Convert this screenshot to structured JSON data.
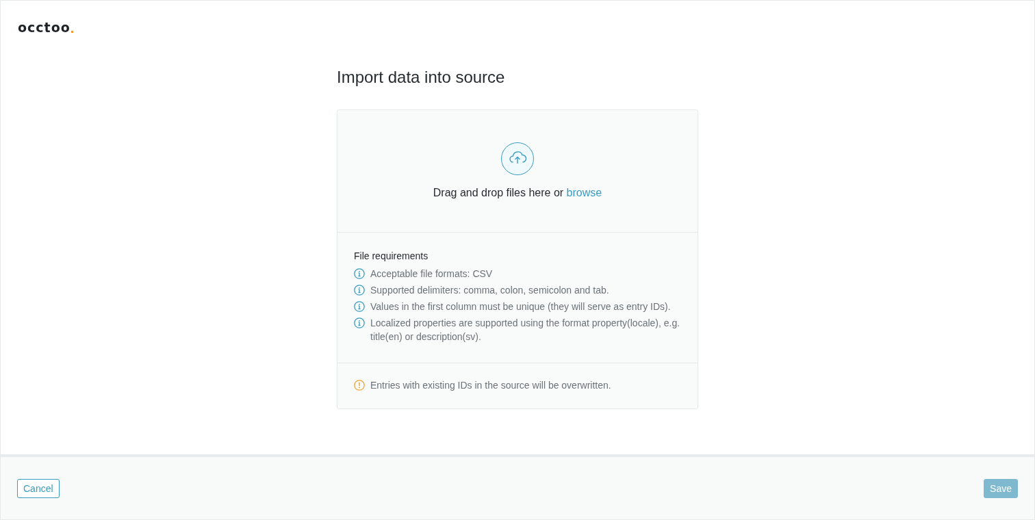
{
  "logo": {
    "text": "occtoo"
  },
  "title": "Import data into source",
  "dropzone": {
    "text": "Drag and drop files here or ",
    "link": "browse"
  },
  "requirements": {
    "heading": "File requirements",
    "items": [
      {
        "kind": "info",
        "text": "Acceptable file formats: CSV"
      },
      {
        "kind": "info",
        "text": "Supported delimiters: comma, colon, semicolon and tab."
      },
      {
        "kind": "info",
        "text": "Values in the first column must be unique (they will serve as entry IDs)."
      },
      {
        "kind": "info",
        "text": "Localized properties are supported using the format property(locale), e.g. title(en) or description(sv)."
      }
    ]
  },
  "notices": [
    {
      "kind": "warning",
      "text": "Entries with existing IDs in the source will be overwritten."
    }
  ],
  "footer": {
    "cancel": {
      "label": "Cancel",
      "disabled": false
    },
    "save": {
      "label": "Save",
      "disabled": true
    }
  }
}
